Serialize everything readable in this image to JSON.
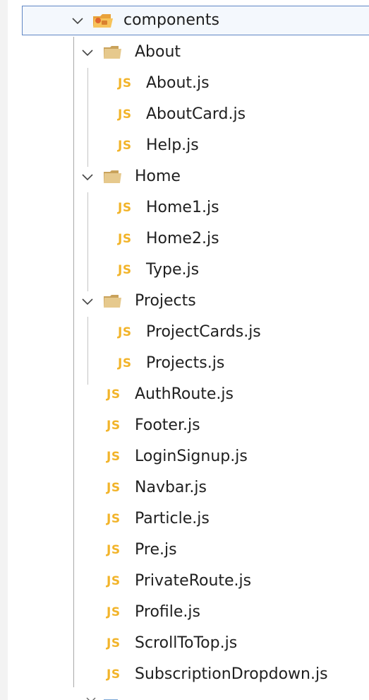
{
  "explorer": {
    "root": {
      "label": "components",
      "icon": "folder-components-icon"
    },
    "about": {
      "label": "About",
      "files": [
        "About.js",
        "AboutCard.js",
        "Help.js"
      ]
    },
    "home": {
      "label": "Home",
      "files": [
        "Home1.js",
        "Home2.js",
        "Type.js"
      ]
    },
    "projects": {
      "label": "Projects",
      "files": [
        "ProjectCards.js",
        "Projects.js"
      ]
    },
    "files": [
      "AuthRoute.js",
      "Footer.js",
      "LoginSignup.js",
      "Navbar.js",
      "Particle.js",
      "Pre.js",
      "PrivateRoute.js",
      "Profile.js",
      "ScrollToTop.js",
      "SubscriptionDropdown.js"
    ],
    "js_badge": "JS"
  },
  "colors": {
    "js_badge": "#f2b42a",
    "folder": "#d8b87a",
    "selection_border": "#5f86c4",
    "text": "#1f1f1f"
  }
}
